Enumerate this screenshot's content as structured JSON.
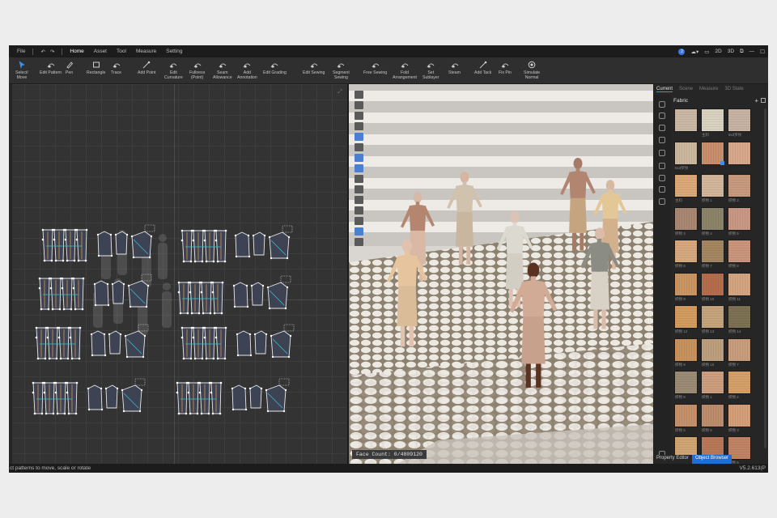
{
  "menubar": {
    "file": "File",
    "undo_icon": "undo-icon",
    "redo_icon": "redo-icon",
    "tabs": [
      {
        "label": "Home",
        "active": true
      },
      {
        "label": "Asset",
        "active": false
      },
      {
        "label": "Tool",
        "active": false
      },
      {
        "label": "Measure",
        "active": false
      },
      {
        "label": "Setting",
        "active": false
      }
    ],
    "notification_count": "2",
    "view_modes": [
      "2D",
      "3D"
    ],
    "accent": "#3a78e0"
  },
  "toolbar": {
    "tools": [
      {
        "name": "select-move",
        "label1": "Select/",
        "label2": "Move",
        "icon": "cursor-icon",
        "selected": true
      },
      {
        "name": "edit-pattern",
        "label1": "Edit Pattern",
        "label2": "",
        "icon": "edit-pattern-icon"
      },
      {
        "name": "pen",
        "label1": "Pen",
        "label2": "",
        "icon": "pen-icon"
      },
      {
        "name": "rectangle",
        "label1": "Rectangle",
        "label2": "",
        "icon": "rectangle-icon"
      },
      {
        "name": "trace",
        "label1": "Trace",
        "label2": "",
        "icon": "trace-icon"
      },
      {
        "name": "add-point",
        "label1": "Add Point",
        "label2": "",
        "icon": "add-point-icon"
      },
      {
        "name": "edit-curvature",
        "label1": "Edit",
        "label2": "Curvature",
        "icon": "curvature-icon"
      },
      {
        "name": "fullness",
        "label1": "Fullness",
        "label2": "(Point)",
        "icon": "fullness-icon"
      },
      {
        "name": "seam-allowance",
        "label1": "Seam",
        "label2": "Allowance",
        "icon": "seam-icon"
      },
      {
        "name": "add-annotation",
        "label1": "Add",
        "label2": "Annotation",
        "icon": "annotation-icon"
      },
      {
        "name": "edit-grading",
        "label1": "Edit Grading",
        "label2": "",
        "icon": "grading-icon"
      },
      {
        "name": "edit-sewing",
        "label1": "Edit Sewing",
        "label2": "",
        "icon": "edit-sewing-icon"
      },
      {
        "name": "segment-sewing",
        "label1": "Segment",
        "label2": "Sewing",
        "icon": "segment-sewing-icon"
      },
      {
        "name": "free-sewing",
        "label1": "Free Sewing",
        "label2": "",
        "icon": "free-sewing-icon"
      },
      {
        "name": "fold-arrangement",
        "label1": "Fold",
        "label2": "Arrangement",
        "icon": "fold-icon"
      },
      {
        "name": "set-sublayer",
        "label1": "Set",
        "label2": "Sublayer",
        "icon": "sublayer-icon"
      },
      {
        "name": "steam",
        "label1": "Steam",
        "label2": "",
        "icon": "steam-icon"
      },
      {
        "name": "add-tack",
        "label1": "Add Tack",
        "label2": "",
        "icon": "tack-icon"
      },
      {
        "name": "fix-pin",
        "label1": "Fix Pin",
        "label2": "",
        "icon": "pin-icon"
      },
      {
        "name": "simulate-normal",
        "label1": "Simulate",
        "label2": "Normal",
        "icon": "simulate-icon"
      }
    ]
  },
  "view3d": {
    "face_count": "Face Count: 0/4809120"
  },
  "rightpanel": {
    "tabs": [
      {
        "label": "Current",
        "active": true
      },
      {
        "label": "Scene",
        "active": false
      },
      {
        "label": "Measure",
        "active": false
      },
      {
        "label": "3D State",
        "active": false
      }
    ],
    "library_title": "Fabric",
    "swatches": [
      {
        "label": "",
        "color": "#c9b8a4"
      },
      {
        "label": "主料",
        "color": "#d9d2c0"
      },
      {
        "label": "5x3罗纹",
        "color": "#c7b3a4"
      },
      {
        "label": "5x3罗纹",
        "color": "#cbb79e"
      },
      {
        "label": "",
        "color": "#c98f6d",
        "selected": true
      },
      {
        "label": "",
        "color": "#d8a88c"
      },
      {
        "label": "主料",
        "color": "#dba978"
      },
      {
        "label": "织物 1",
        "color": "#d2b699"
      },
      {
        "label": "织物 2",
        "color": "#c79a7f"
      },
      {
        "label": "织物 3",
        "color": "#a98772"
      },
      {
        "label": "织物 4",
        "color": "#8c8468"
      },
      {
        "label": "织物 5",
        "color": "#c99885"
      },
      {
        "label": "织物 6",
        "color": "#d6a880"
      },
      {
        "label": "织物 7",
        "color": "#a48661"
      },
      {
        "label": "织物 8",
        "color": "#c9957c"
      },
      {
        "label": "织物 9",
        "color": "#c99562"
      },
      {
        "label": "织物 10",
        "color": "#b46d4d"
      },
      {
        "label": "织物 11",
        "color": "#d3a482"
      },
      {
        "label": "织物 12",
        "color": "#d29b60"
      },
      {
        "label": "织物 13",
        "color": "#c5a47c"
      },
      {
        "label": "织物 14",
        "color": "#7d7153"
      },
      {
        "label": "织物 9",
        "color": "#c8925f"
      },
      {
        "label": "织物 10",
        "color": "#bca07d"
      },
      {
        "label": "织物 7",
        "color": "#c79d7d"
      },
      {
        "label": "织物 8",
        "color": "#9b8b75"
      },
      {
        "label": "织物 1",
        "color": "#cc9e7e"
      },
      {
        "label": "织物 2",
        "color": "#d4a06a"
      },
      {
        "label": "织物 5",
        "color": "#c5916b"
      },
      {
        "label": "织物 6",
        "color": "#bc8c6c"
      },
      {
        "label": "织物 3",
        "color": "#d49e79"
      },
      {
        "label": "织物 4",
        "color": "#d0a574"
      },
      {
        "label": "织物 5",
        "color": "#b87858"
      },
      {
        "label": "织物 6",
        "color": "#c18365"
      },
      {
        "label": "",
        "color": "#d9cfb8"
      },
      {
        "label": "",
        "color": "#ded4bc"
      },
      {
        "label": "",
        "color": "#c88a6a"
      }
    ]
  },
  "bottomtabs": [
    {
      "label": "Property Editor",
      "active": false
    },
    {
      "label": "Object Browser",
      "active": true
    }
  ],
  "statusbar": {
    "message": "ct patterns to move, scale or rotate",
    "version": "V5.2.613(P"
  }
}
